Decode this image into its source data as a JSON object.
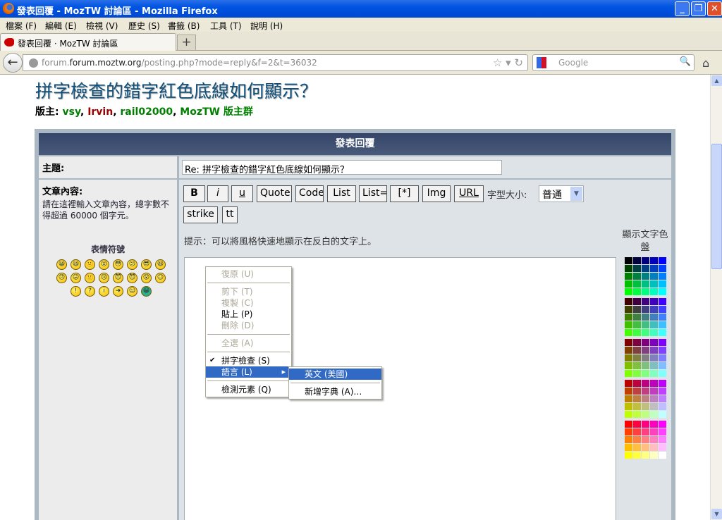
{
  "window": {
    "title": "發表回覆 - MozTW 討論區 - Mozilla Firefox",
    "min": "_",
    "max": "❐",
    "close": "✕"
  },
  "menu": [
    "檔案 (F)",
    "編輯 (E)",
    "檢視 (V)",
    "歷史 (S)",
    "書籤 (B)",
    "工具 (T)",
    "說明 (H)"
  ],
  "tab": {
    "label": "發表回覆 · MozTW 討論區",
    "new": "+"
  },
  "nav": {
    "back": "←",
    "url_domain": "forum.moztw.org",
    "url_host_prefix": "forum.",
    "url_path": "/posting.php?mode=reply&f=2&t=36032",
    "search_placeholder": "Google",
    "home": "⌂",
    "star": "☆ ▾ ↻",
    "magnifier": "🔍"
  },
  "page": {
    "title": "拼字檢查的錯字紅色底線如何顯示？",
    "mods_label": "版主:",
    "mods": [
      {
        "name": "vsy",
        "color": "g"
      },
      {
        "name": "Irvin",
        "color": "r"
      },
      {
        "name": "rail02000",
        "color": "g"
      },
      {
        "name": "MozTW 版主群",
        "color": "g"
      }
    ],
    "form_header": "發表回覆",
    "subject_label": "主題:",
    "subject_value": "Re: 拼字檢查的錯字紅色底線如何顯示？",
    "body_label": "文章內容:",
    "body_hint": "請在這裡輸入文章內容，總字數不得超過 60000 個字元。",
    "emoticons_label": "表情符號",
    "emoticons": [
      "😀",
      "😃",
      "🙁",
      "😮",
      "😳",
      "😕",
      "😎",
      "😆",
      "😠",
      "😛",
      "🙂",
      "😢",
      "😈",
      "😈",
      "😵",
      "😉",
      "!",
      "?",
      "i",
      "➜",
      "😐",
      "😁"
    ],
    "buttons": [
      "B",
      "i",
      "u",
      "Quote",
      "Code",
      "List",
      "List=",
      "[*]",
      "Img",
      "URL",
      "strike",
      "tt"
    ],
    "font_size_label": "字型大小:",
    "font_size_value": "普通",
    "tip": "提示：可以將風格快速地顯示在反白的文字上。",
    "palette_label": "顯示文字色盤",
    "palette_levels": [
      "00",
      "40",
      "80",
      "BF",
      "FF"
    ]
  },
  "context_menu": {
    "items": [
      {
        "label": "復原 (U)",
        "disabled": true
      },
      {
        "sep": true
      },
      {
        "label": "剪下 (T)",
        "disabled": true
      },
      {
        "label": "複製 (C)",
        "disabled": true
      },
      {
        "label": "貼上 (P)",
        "disabled": false
      },
      {
        "label": "刪除 (D)",
        "disabled": true
      },
      {
        "sep": true
      },
      {
        "label": "全選 (A)",
        "disabled": true
      },
      {
        "sep": true
      },
      {
        "label": "拼字檢查 (S)",
        "checked": true
      },
      {
        "label": "語言 (L)",
        "selected": true,
        "submenu": true
      },
      {
        "sep": true
      },
      {
        "label": "檢測元素 (Q)"
      }
    ],
    "submenu": [
      {
        "label": "英文 (美國)",
        "selected": true
      },
      {
        "sep": true
      },
      {
        "label": "新增字典 (A)…"
      }
    ]
  }
}
